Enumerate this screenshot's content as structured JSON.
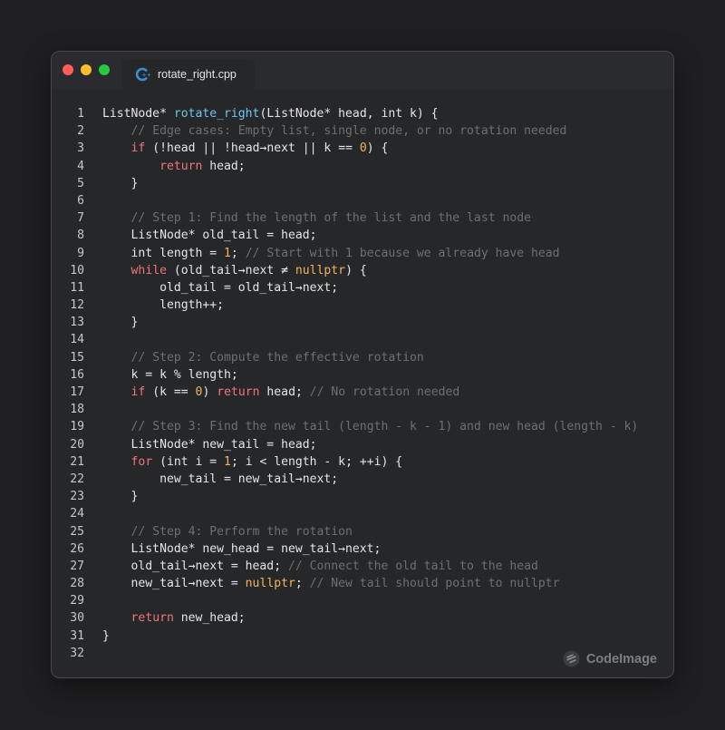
{
  "window": {
    "tab_label": "rotate_right.cpp",
    "traffic_lights": {
      "close": "#ff5f57",
      "minimize": "#febc2e",
      "maximize": "#28c840"
    },
    "file_icon": "cpp-file-icon",
    "watermark": "CodeImage"
  },
  "colors": {
    "background": "#1f1f21",
    "window": "#262729",
    "keyword": "#f0747c",
    "function": "#6fc6f0",
    "number": "#f3b25f",
    "comment": "#6d6f74",
    "plain": "#e6e6ea",
    "line_number": "#c7c7cb"
  },
  "code": {
    "lines": [
      {
        "n": "1",
        "tokens": [
          [
            "plain",
            "ListNode* "
          ],
          [
            "function",
            "rotate_right"
          ],
          [
            "plain",
            "(ListNode* head, int k) {"
          ]
        ]
      },
      {
        "n": "2",
        "tokens": [
          [
            "plain",
            "    "
          ],
          [
            "comment",
            "// Edge cases: Empty list, single node, or no rotation needed"
          ]
        ]
      },
      {
        "n": "3",
        "tokens": [
          [
            "plain",
            "    "
          ],
          [
            "keyword",
            "if"
          ],
          [
            "plain",
            " (!head || !head→next || k "
          ],
          [
            "plain",
            "=="
          ],
          [
            "plain",
            " "
          ],
          [
            "number",
            "0"
          ],
          [
            "plain",
            ") {"
          ]
        ]
      },
      {
        "n": "4",
        "tokens": [
          [
            "plain",
            "        "
          ],
          [
            "keyword",
            "return"
          ],
          [
            "plain",
            " head;"
          ]
        ]
      },
      {
        "n": "5",
        "tokens": [
          [
            "plain",
            "    }"
          ]
        ]
      },
      {
        "n": "6",
        "tokens": []
      },
      {
        "n": "7",
        "tokens": [
          [
            "plain",
            "    "
          ],
          [
            "comment",
            "// Step 1: Find the length of the list and the last node"
          ]
        ]
      },
      {
        "n": "8",
        "tokens": [
          [
            "plain",
            "    ListNode* old_tail = head;"
          ]
        ]
      },
      {
        "n": "9",
        "tokens": [
          [
            "plain",
            "    int length = "
          ],
          [
            "number",
            "1"
          ],
          [
            "plain",
            "; "
          ],
          [
            "comment",
            "// Start with 1 because we already have head"
          ]
        ]
      },
      {
        "n": "10",
        "tokens": [
          [
            "plain",
            "    "
          ],
          [
            "keyword",
            "while"
          ],
          [
            "plain",
            " (old_tail→next ≠ "
          ],
          [
            "number",
            "nullptr"
          ],
          [
            "plain",
            ") {"
          ]
        ]
      },
      {
        "n": "11",
        "tokens": [
          [
            "plain",
            "        old_tail = old_tail→next;"
          ]
        ]
      },
      {
        "n": "12",
        "tokens": [
          [
            "plain",
            "        length++;"
          ]
        ]
      },
      {
        "n": "13",
        "tokens": [
          [
            "plain",
            "    }"
          ]
        ]
      },
      {
        "n": "14",
        "tokens": []
      },
      {
        "n": "15",
        "tokens": [
          [
            "plain",
            "    "
          ],
          [
            "comment",
            "// Step 2: Compute the effective rotation"
          ]
        ]
      },
      {
        "n": "16",
        "tokens": [
          [
            "plain",
            "    k = k % length;"
          ]
        ]
      },
      {
        "n": "17",
        "tokens": [
          [
            "plain",
            "    "
          ],
          [
            "keyword",
            "if"
          ],
          [
            "plain",
            " (k "
          ],
          [
            "plain",
            "=="
          ],
          [
            "plain",
            " "
          ],
          [
            "number",
            "0"
          ],
          [
            "plain",
            ") "
          ],
          [
            "keyword",
            "return"
          ],
          [
            "plain",
            " head; "
          ],
          [
            "comment",
            "// No rotation needed"
          ]
        ]
      },
      {
        "n": "18",
        "tokens": []
      },
      {
        "n": "19",
        "tokens": [
          [
            "plain",
            "    "
          ],
          [
            "comment",
            "// Step 3: Find the new tail (length - k - 1) and new head (length - k)"
          ]
        ]
      },
      {
        "n": "20",
        "tokens": [
          [
            "plain",
            "    ListNode* new_tail = head;"
          ]
        ]
      },
      {
        "n": "21",
        "tokens": [
          [
            "plain",
            "    "
          ],
          [
            "keyword",
            "for"
          ],
          [
            "plain",
            " (int i = "
          ],
          [
            "number",
            "1"
          ],
          [
            "plain",
            "; i < length - k; ++i) {"
          ]
        ]
      },
      {
        "n": "22",
        "tokens": [
          [
            "plain",
            "        new_tail = new_tail→next;"
          ]
        ]
      },
      {
        "n": "23",
        "tokens": [
          [
            "plain",
            "    }"
          ]
        ]
      },
      {
        "n": "24",
        "tokens": []
      },
      {
        "n": "25",
        "tokens": [
          [
            "plain",
            "    "
          ],
          [
            "comment",
            "// Step 4: Perform the rotation"
          ]
        ]
      },
      {
        "n": "26",
        "tokens": [
          [
            "plain",
            "    ListNode* new_head = new_tail→next;"
          ]
        ]
      },
      {
        "n": "27",
        "tokens": [
          [
            "plain",
            "    old_tail→next = head; "
          ],
          [
            "comment",
            "// Connect the old tail to the head"
          ]
        ]
      },
      {
        "n": "28",
        "tokens": [
          [
            "plain",
            "    new_tail→next = "
          ],
          [
            "number",
            "nullptr"
          ],
          [
            "plain",
            "; "
          ],
          [
            "comment",
            "// New tail should point to nullptr"
          ]
        ]
      },
      {
        "n": "29",
        "tokens": []
      },
      {
        "n": "30",
        "tokens": [
          [
            "plain",
            "    "
          ],
          [
            "keyword",
            "return"
          ],
          [
            "plain",
            " new_head;"
          ]
        ]
      },
      {
        "n": "31",
        "tokens": [
          [
            "plain",
            "}"
          ]
        ]
      },
      {
        "n": "32",
        "tokens": []
      }
    ]
  }
}
